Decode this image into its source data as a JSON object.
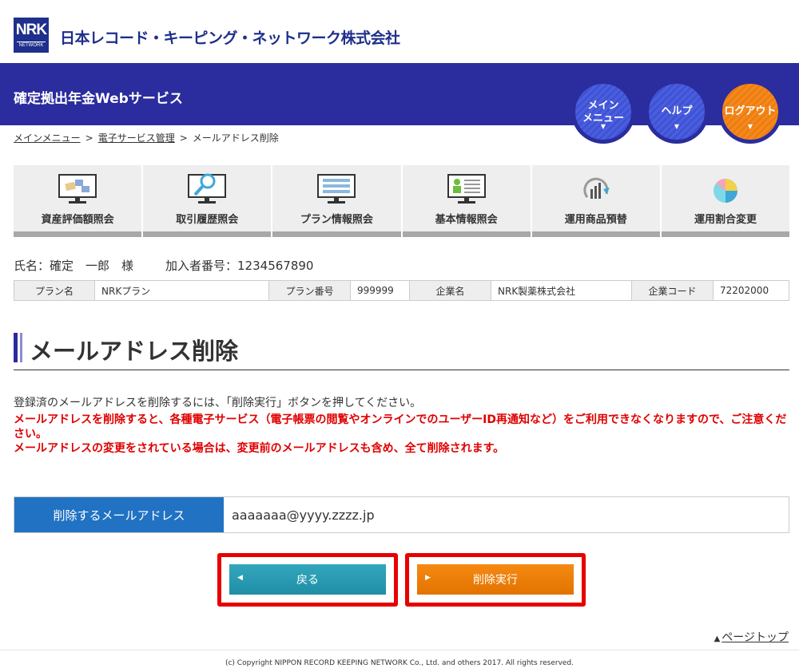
{
  "header": {
    "logo_main": "NRK",
    "logo_sub": "NETWORK",
    "company_name": "日本レコード・キーピング・ネットワーク株式会社",
    "service_title": "確定拠出年金Webサービス"
  },
  "nav_buttons": {
    "main_menu_line1": "メイン",
    "main_menu_line2": "メニュー",
    "help": "ヘルプ",
    "logout": "ログアウト",
    "arrow": "▼"
  },
  "breadcrumb": {
    "items": [
      "メインメニュー",
      "電子サービス管理",
      "メールアドレス削除"
    ],
    "separator": ">"
  },
  "tiles": [
    {
      "label": "資産評価額照会",
      "icon": "asset-monitor-icon"
    },
    {
      "label": "取引履歴照会",
      "icon": "magnifier-monitor-icon"
    },
    {
      "label": "プラン情報照会",
      "icon": "plan-monitor-icon"
    },
    {
      "label": "基本情報照会",
      "icon": "profile-monitor-icon"
    },
    {
      "label": "運用商品預替",
      "icon": "rotate-chart-icon"
    },
    {
      "label": "運用割合変更",
      "icon": "pie-chart-icon"
    }
  ],
  "user": {
    "name": "氏名：確定　一郎　様",
    "member_no": "加入者番号：1234567890"
  },
  "plan_table": {
    "plan_name_label": "プラン名",
    "plan_name": "NRKプラン",
    "plan_no_label": "プラン番号",
    "plan_no": "999999",
    "company_label": "企業名",
    "company": "NRK製薬株式会社",
    "company_code_label": "企業コード",
    "company_code": "72202000"
  },
  "page": {
    "title": "メールアドレス削除",
    "instruction": "登録済のメールアドレスを削除するには、「削除実行」ボタンを押してください。",
    "warning1": "メールアドレスを削除すると、各種電子サービス（電子帳票の閲覧やオンラインでのユーザーID再通知など）をご利用できなくなりますので、ご注意ください。",
    "warning2": "メールアドレスの変更をされている場合は、変更前のメールアドレスも含め、全て削除されます。"
  },
  "email": {
    "label": "削除するメールアドレス",
    "value": "aaaaaaa@yyyy.zzzz.jp"
  },
  "buttons": {
    "back": "戻る",
    "back_arrow": "◀",
    "execute": "削除実行",
    "execute_arrow": "▶"
  },
  "footer": {
    "pagetop_arrow": "▲",
    "pagetop": "ページトップ",
    "copyright": "(c) Copyright NIPPON RECORD KEEPING NETWORK Co., Ltd. and others 2017. All rights reserved."
  },
  "colors": {
    "brand_blue": "#2b2c9d",
    "logout_orange": "#f5891c",
    "email_label_blue": "#2172c3",
    "warning_red": "#e00000",
    "highlight_red": "#e60000"
  }
}
